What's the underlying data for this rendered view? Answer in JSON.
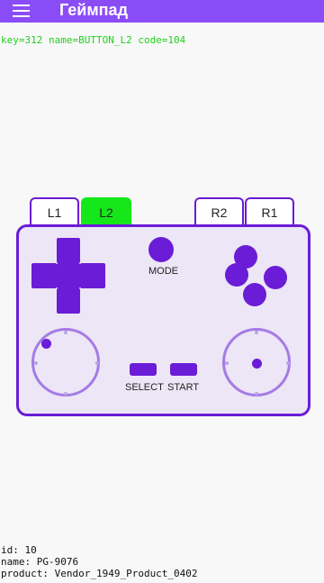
{
  "app": {
    "title": "Геймпад"
  },
  "event": {
    "text": "key=312 name=BUTTON_L2 code=104"
  },
  "shoulders": {
    "l1": "L1",
    "l2": "L2",
    "r2": "R2",
    "r1": "R1",
    "active": "L2",
    "active_color": "#16e71a"
  },
  "buttons": {
    "mode": "MODE",
    "select": "SELECT",
    "start": "START"
  },
  "device": {
    "id": "id: 10",
    "name": "name: PG-9076",
    "product": "product: Vendor_1949_Product_0402"
  },
  "colors": {
    "accent": "#8a4cf6",
    "controls": "#6a1cd6",
    "body": "#ece6f6"
  },
  "icons": {
    "menu": "hamburger-menu-icon"
  }
}
